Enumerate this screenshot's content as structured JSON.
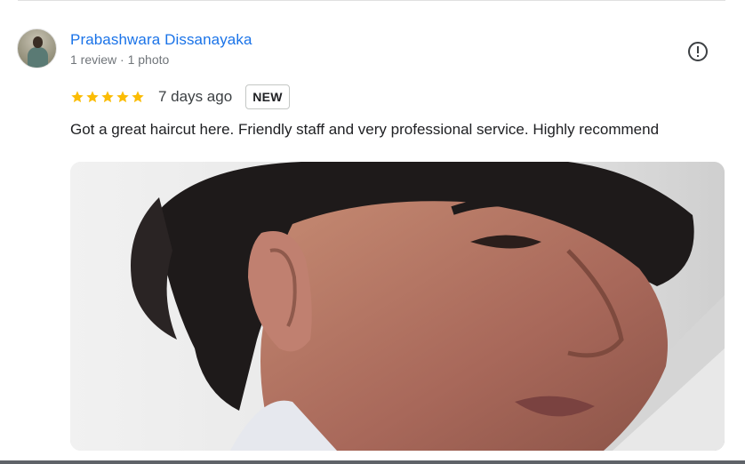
{
  "review": {
    "reviewer_name": "Prabashwara Dissanayaka",
    "reviewer_meta": "1 review · 1 photo",
    "rating": 5,
    "rating_max": 5,
    "date": "7 days ago",
    "badge": "NEW",
    "text": "Got a great haircut here. Friendly staff and very professional service. Highly recommend",
    "icons": {
      "report": "report-icon",
      "star": "star-icon"
    }
  },
  "colors": {
    "name_link": "#1a73e8",
    "star": "#fbbc04",
    "meta": "#70757a"
  }
}
